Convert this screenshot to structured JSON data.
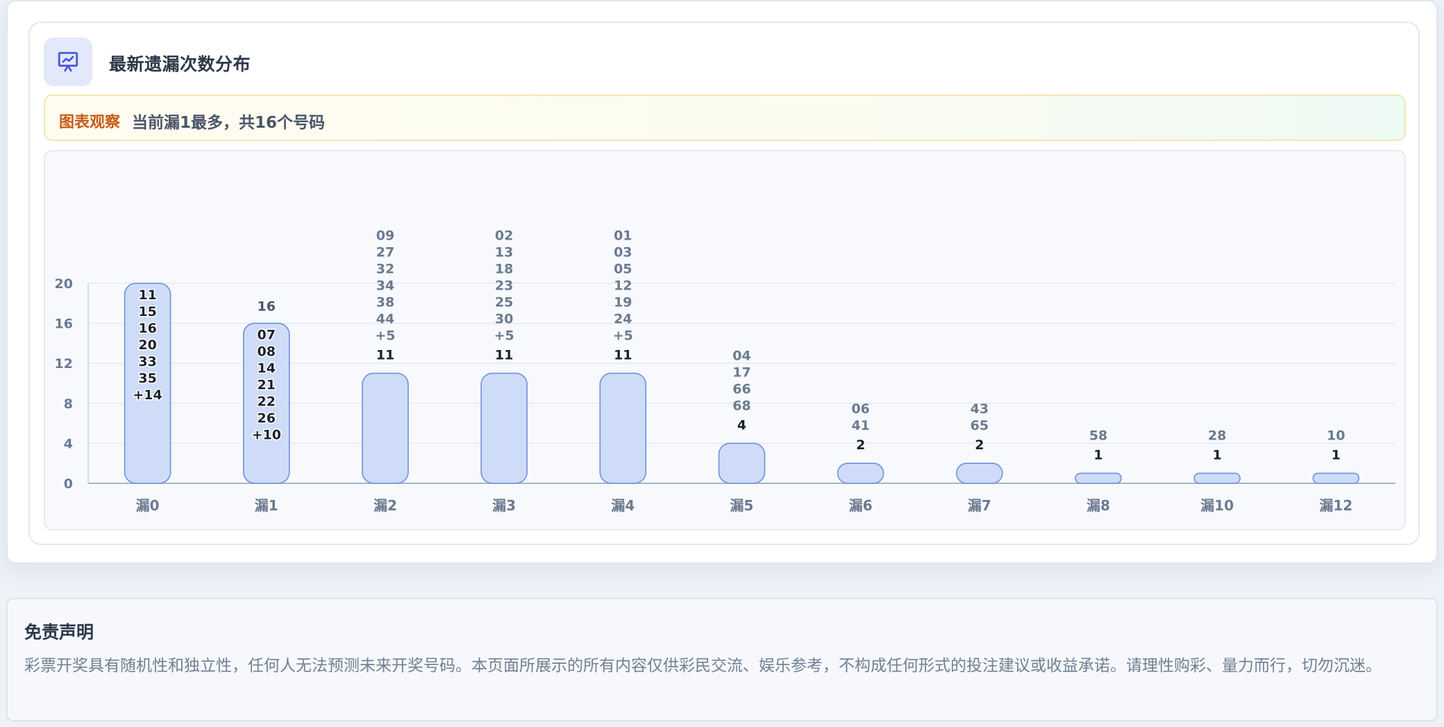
{
  "header": {
    "title": "最新遗漏次数分布",
    "icon": "presentation-chart-icon"
  },
  "insight": {
    "tag": "图表观察",
    "text": "当前漏1最多，共16个号码"
  },
  "colors": {
    "bar_fill": "#cfdcf7",
    "bar_stroke": "#6e8fdf",
    "label_muted": "#6b7a90",
    "label_dark": "#1a202c",
    "tag": "#c75a12",
    "icon": "#4b58d6"
  },
  "chart_data": {
    "type": "bar",
    "categories": [
      "漏0",
      "漏1",
      "漏2",
      "漏3",
      "漏4",
      "漏5",
      "漏6",
      "漏7",
      "漏8",
      "漏10",
      "漏12"
    ],
    "values": [
      20,
      16,
      11,
      11,
      11,
      4,
      2,
      2,
      1,
      1,
      1
    ],
    "value_labels": [
      "",
      "16",
      "11",
      "11",
      "11",
      "4",
      "2",
      "2",
      "1",
      "1",
      "1"
    ],
    "numbers": [
      [
        "11",
        "15",
        "16",
        "20",
        "33",
        "35",
        "+14"
      ],
      [
        "07",
        "08",
        "14",
        "21",
        "22",
        "26",
        "+10"
      ],
      [
        "09",
        "27",
        "32",
        "34",
        "38",
        "44",
        "+5"
      ],
      [
        "02",
        "13",
        "18",
        "23",
        "25",
        "30",
        "+5"
      ],
      [
        "01",
        "03",
        "05",
        "12",
        "19",
        "24",
        "+5"
      ],
      [
        "04",
        "17",
        "66",
        "68"
      ],
      [
        "06",
        "41"
      ],
      [
        "43",
        "65"
      ],
      [
        "58"
      ],
      [
        "28"
      ],
      [
        "10"
      ]
    ],
    "inside_numbers": [
      true,
      true,
      false,
      false,
      false,
      false,
      false,
      false,
      false,
      false,
      false
    ],
    "yticks": [
      0,
      4,
      8,
      12,
      16,
      20
    ],
    "ylim": [
      0,
      20
    ],
    "grid": true,
    "xlabel": "",
    "ylabel": ""
  },
  "disclaimer": {
    "title": "免责声明",
    "text": "彩票开奖具有随机性和独立性，任何人无法预测未来开奖号码。本页面所展示的所有内容仅供彩民交流、娱乐参考，不构成任何形式的投注建议或收益承诺。请理性购彩、量力而行，切勿沉迷。"
  }
}
